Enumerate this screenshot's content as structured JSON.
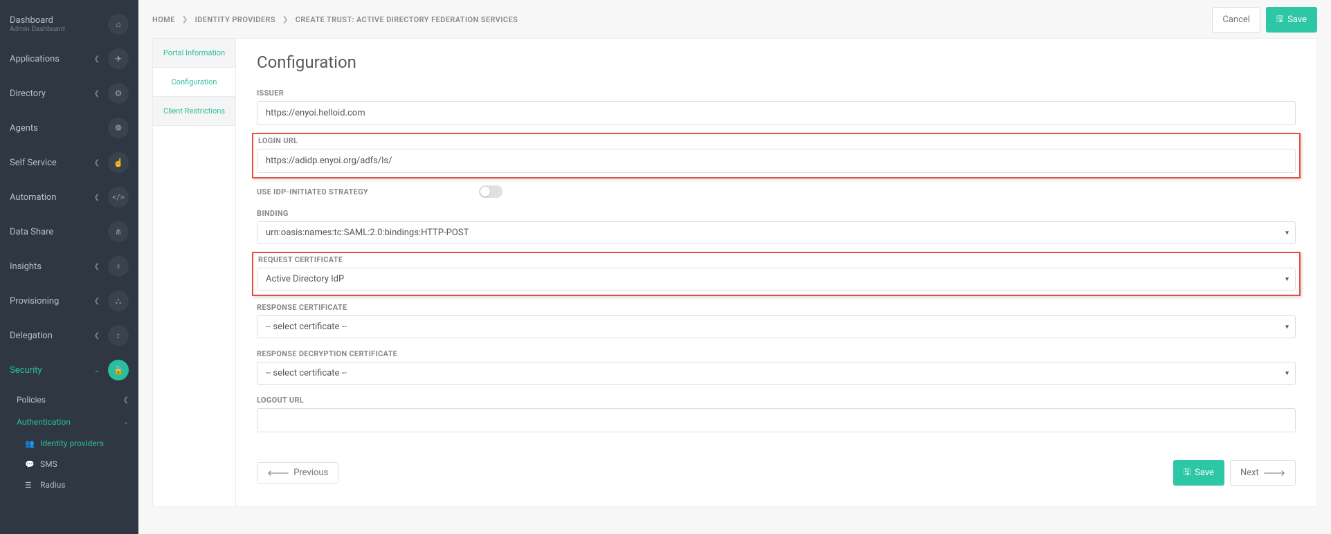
{
  "sidebar": {
    "dashboard": {
      "label": "Dashboard",
      "sub": "Admin Dashboard",
      "icon": "⌂"
    },
    "applications": {
      "label": "Applications",
      "icon": "✈"
    },
    "directory": {
      "label": "Directory",
      "icon": "⚙"
    },
    "agents": {
      "label": "Agents",
      "icon": "❁"
    },
    "selfservice": {
      "label": "Self Service",
      "icon": "☝"
    },
    "automation": {
      "label": "Automation",
      "icon": "</>"
    },
    "datashare": {
      "label": "Data Share",
      "icon": "⋔"
    },
    "insights": {
      "label": "Insights",
      "icon": "♀"
    },
    "provisioning": {
      "label": "Provisioning",
      "icon": "⛬"
    },
    "delegation": {
      "label": "Delegation",
      "icon": "↕"
    },
    "security": {
      "label": "Security",
      "icon": "🔒"
    },
    "policies": {
      "label": "Policies"
    },
    "authentication": {
      "label": "Authentication"
    },
    "idp": {
      "label": "Identity providers"
    },
    "sms": {
      "label": "SMS"
    },
    "radius": {
      "label": "Radius"
    }
  },
  "breadcrumb": {
    "home": "HOME",
    "idp": "IDENTITY PROVIDERS",
    "current": "CREATE TRUST: ACTIVE DIRECTORY FEDERATION SERVICES"
  },
  "actions": {
    "cancel": "Cancel",
    "save": "Save",
    "previous": "Previous",
    "next": "Next"
  },
  "tabs": {
    "portal": "Portal Information",
    "config": "Configuration",
    "client": "Client Restrictions"
  },
  "form": {
    "title": "Configuration",
    "issuer_label": "ISSUER",
    "issuer_value": "https://enyoi.helloid.com",
    "login_url_label": "LOGIN URL",
    "login_url_value": "https://adidp.enyoi.org/adfs/ls/",
    "idp_initiated_label": "USE IDP-INITIATED STRATEGY",
    "binding_label": "BINDING",
    "binding_value": "urn:oasis:names:tc:SAML:2.0:bindings:HTTP-POST",
    "req_cert_label": "REQUEST CERTIFICATE",
    "req_cert_value": "Active Directory IdP",
    "resp_cert_label": "RESPONSE CERTIFICATE",
    "resp_cert_value": "-- select certificate --",
    "resp_decrypt_label": "RESPONSE DECRYPTION CERTIFICATE",
    "resp_decrypt_value": "-- select certificate --",
    "logout_url_label": "LOGOUT URL",
    "logout_url_value": ""
  }
}
